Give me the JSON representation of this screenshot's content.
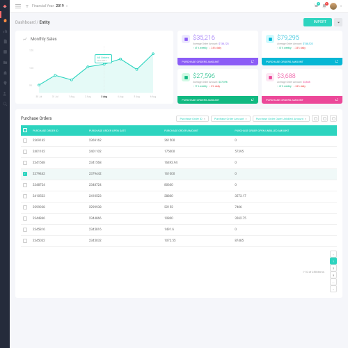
{
  "topbar": {
    "year_label": "Financial Year:",
    "year": "2019",
    "cart_badge": "2",
    "bell_badge": "9"
  },
  "breadcrumb": {
    "root": "Dashboard",
    "sep": " / ",
    "current": "Entity",
    "import": "IMPORT"
  },
  "chart_data": {
    "type": "line",
    "title": "Monthly Sales",
    "x": [
      "30 Jul",
      "31 Jul",
      "1 Aug",
      "2 Aug",
      "3 Aug",
      "4 Aug",
      "5 Aug",
      "6 Aug"
    ],
    "values": [
      35,
      68,
      55,
      95,
      105,
      125,
      90,
      145
    ],
    "ylim": [
      0,
      150
    ],
    "yticks": [
      50,
      100,
      150
    ],
    "tooltip": {
      "title": "68 Orders",
      "sub": "AUG 2017",
      "index": 1
    }
  },
  "stats": [
    {
      "amount": "$35,216",
      "avg_label": "Average Order Amount:",
      "avg": "$138,123",
      "weekly": "↑ 41% weekly",
      "daily": "↓ 24% daily",
      "footer": "PURCHASE ORDERS AMOUNT",
      "icon_bg": "#ede9fe",
      "icon_color": "#8b5cf6",
      "text_color": "#8b5cf6",
      "footer_bg": "#8b5cf6"
    },
    {
      "amount": "$79,295",
      "avg_label": "Average Order Amount:",
      "avg": "$138,123",
      "weekly": "↑ 41% weekly",
      "daily": "↓ 24% daily",
      "footer": "PURCHASE ORDERS AMOUNT",
      "icon_bg": "#cffafe",
      "icon_color": "#06b6d4",
      "text_color": "#06b6d4",
      "footer_bg": "#06b6d4"
    },
    {
      "amount": "$27,596",
      "avg_label": "Average Order Amount:",
      "avg": "$37,596",
      "weekly": "↑ 11% weekly",
      "daily": "↓ 8% daily",
      "footer": "PURCHASE ORDERS AMOUNT",
      "icon_bg": "#d1fae5",
      "icon_color": "#10b981",
      "text_color": "#10b981",
      "footer_bg": "#10b981"
    },
    {
      "amount": "$3,688",
      "avg_label": "Average Order Amount:",
      "avg": "$3,688",
      "weekly": "↑ 41% weekly",
      "daily": "↓ 24% daily",
      "footer": "PURCHASE ORDERS AMOUNT",
      "icon_bg": "#fce7f3",
      "icon_color": "#ec4899",
      "text_color": "#ec4899",
      "footer_bg": "#ec4899"
    }
  ],
  "table": {
    "title": "Purchase Orders",
    "chips": [
      "Purchase Order ID",
      "Purchase Order Amount",
      "Purchase Order Open Unbilled Amount"
    ],
    "columns": [
      "",
      "PURCHASE ORDER ID",
      "",
      "PURCHASE ORDER OPEN DATE",
      "",
      "PURCHASE ORDER AMOUNT",
      "",
      "PURCHASE ORDER OPEN UNBILLED AMOUNT",
      ""
    ],
    "rows": [
      {
        "sel": false,
        "id": "2369162",
        "date": "2369162",
        "amount": "361500",
        "unbilled": "0"
      },
      {
        "sel": false,
        "id": "2401102",
        "date": "2401102",
        "amount": "175000",
        "unbilled": "57395"
      },
      {
        "sel": false,
        "id": "2341568",
        "date": "2341568",
        "amount": "16492.94",
        "unbilled": "0"
      },
      {
        "sel": true,
        "id": "2379442",
        "date": "2379442",
        "amount": "161000",
        "unbilled": "0"
      },
      {
        "sel": false,
        "id": "2348724",
        "date": "2348724",
        "amount": "80600",
        "unbilled": "0"
      },
      {
        "sel": false,
        "id": "2410523",
        "date": "2410523",
        "amount": "28800",
        "unbilled": "3573.17"
      },
      {
        "sel": false,
        "id": "2299938",
        "date": "2299938",
        "amount": "22152",
        "unbilled": "7406"
      },
      {
        "sel": false,
        "id": "2344866",
        "date": "2344866",
        "amount": "10800",
        "unbilled": "3262.75"
      },
      {
        "sel": false,
        "id": "2345816",
        "date": "2345816",
        "amount": "1491.6",
        "unbilled": "0"
      },
      {
        "sel": false,
        "id": "2345032",
        "date": "2345032",
        "amount": "1072.55",
        "unbilled": "87485"
      }
    ],
    "page_info": "1-10 of 255 items",
    "pages": [
      "‹",
      "1",
      "2",
      "3",
      "...",
      "›"
    ]
  },
  "colors": {
    "teal": "#2dd4bf",
    "bg": "#f5f6fa"
  }
}
